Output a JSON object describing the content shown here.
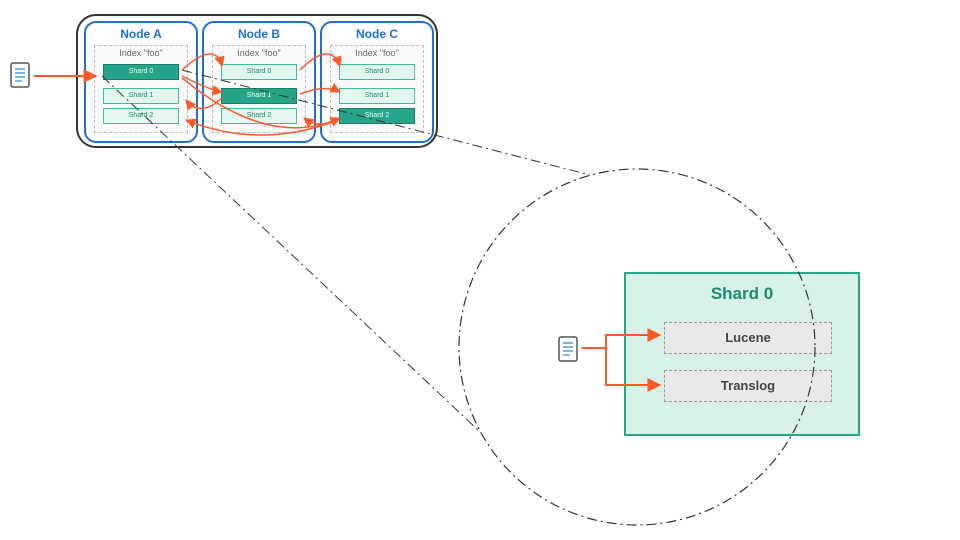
{
  "cluster": {
    "nodes": [
      {
        "title": "Node A",
        "index_label": "Index \"foo\"",
        "shards": [
          {
            "label": "Shard 0",
            "primary": true
          },
          {
            "label": "Shard 1",
            "primary": false
          },
          {
            "label": "Shard 2",
            "primary": false
          }
        ]
      },
      {
        "title": "Node B",
        "index_label": "Index \"foo\"",
        "shards": [
          {
            "label": "Shard 0",
            "primary": false
          },
          {
            "label": "Shard 1",
            "primary": true
          },
          {
            "label": "Shard 2",
            "primary": false
          }
        ]
      },
      {
        "title": "Node C",
        "index_label": "Index \"foo\"",
        "shards": [
          {
            "label": "Shard 0",
            "primary": false
          },
          {
            "label": "Shard 1",
            "primary": false
          },
          {
            "label": "Shard 2",
            "primary": true
          }
        ]
      }
    ]
  },
  "detail": {
    "title": "Shard 0",
    "boxes": [
      {
        "label": "Lucene"
      },
      {
        "label": "Translog"
      }
    ]
  },
  "icons": {
    "doc_top": "document-icon",
    "doc_bottom": "document-icon"
  },
  "diagram_type": "cluster-shard-zoom"
}
